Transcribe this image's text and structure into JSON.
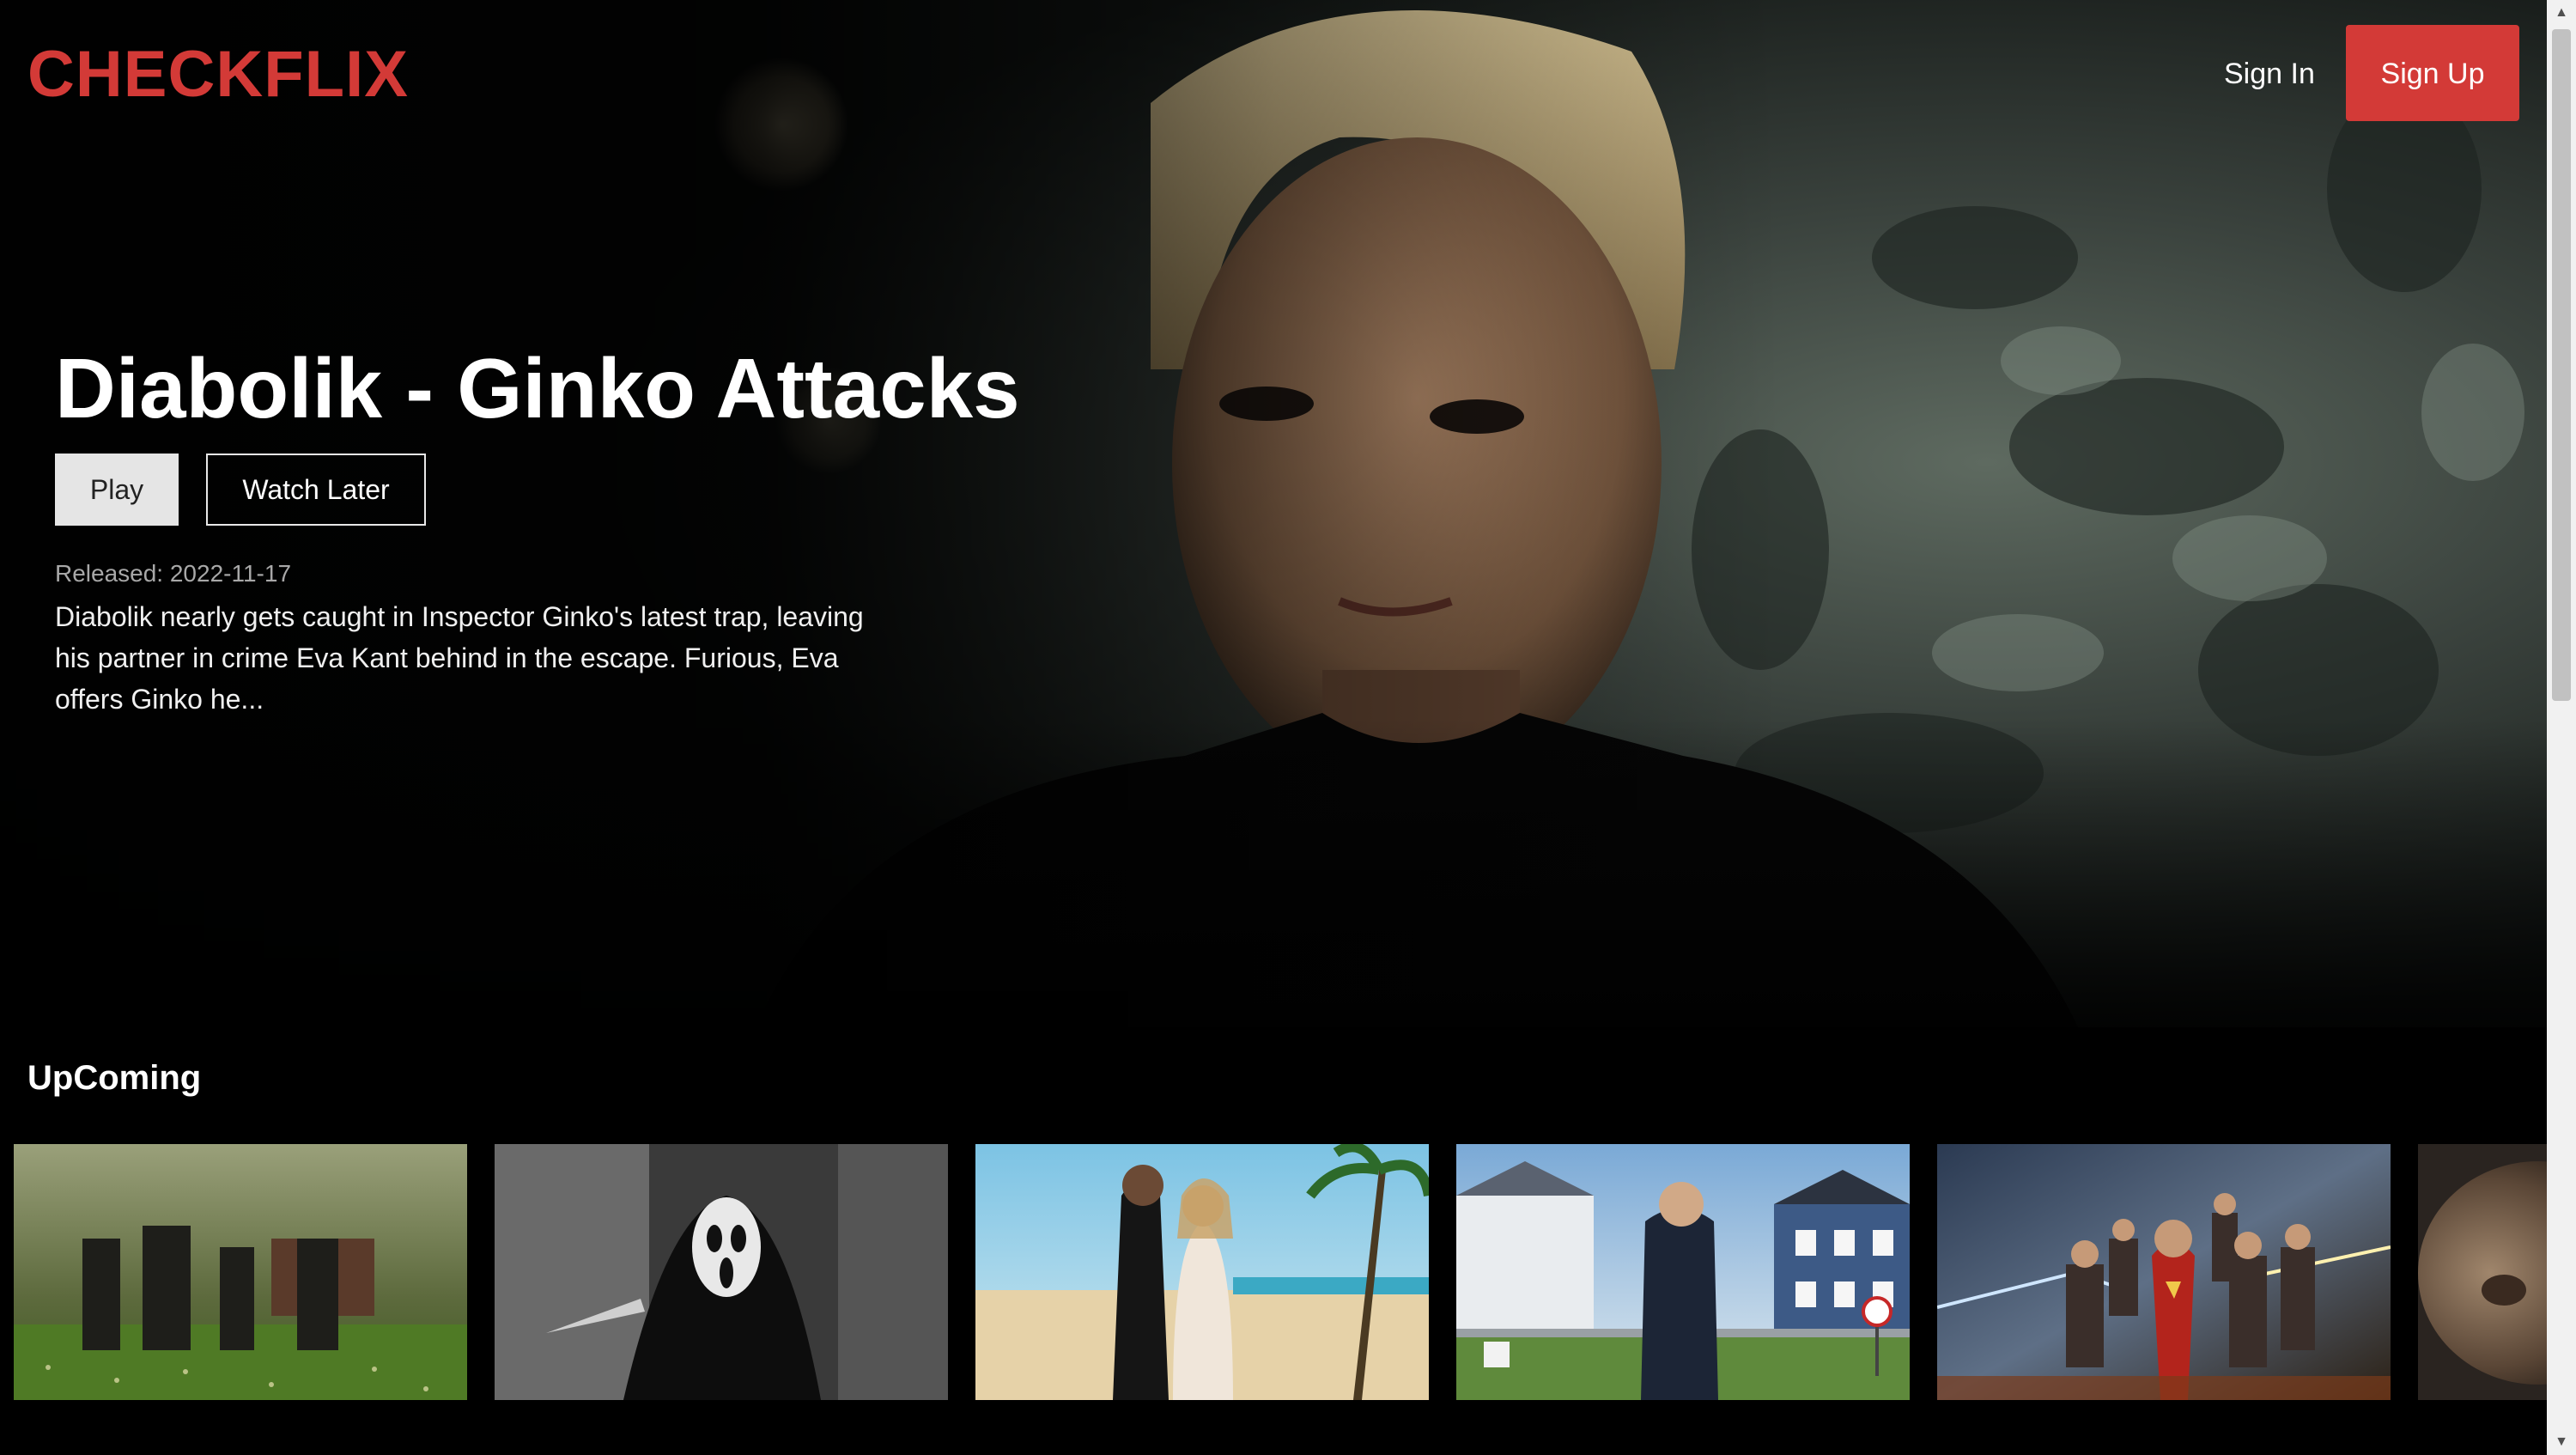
{
  "brand": {
    "logo_text": "CHECKFLIX",
    "accent_color": "#d33a37"
  },
  "nav": {
    "sign_in_label": "Sign In",
    "sign_up_label": "Sign Up"
  },
  "hero": {
    "title": "Diabolik - Ginko Attacks",
    "play_label": "Play",
    "watch_later_label": "Watch Later",
    "released": "Released: 2022-11-17",
    "overview": "Diabolik nearly gets caught in Inspector Ginko's latest trap, leaving his partner in crime Eva Kant behind in the escape. Furious, Eva offers Ginko he..."
  },
  "row": {
    "title": "UpComing",
    "items": [
      {
        "poster": "backdrop-1"
      },
      {
        "poster": "backdrop-2"
      },
      {
        "poster": "backdrop-3"
      },
      {
        "poster": "backdrop-4"
      },
      {
        "poster": "backdrop-5"
      },
      {
        "poster": "backdrop-6"
      }
    ]
  },
  "icons": {
    "scroll_up": "chevron-up-icon",
    "scroll_down": "chevron-down-icon"
  }
}
